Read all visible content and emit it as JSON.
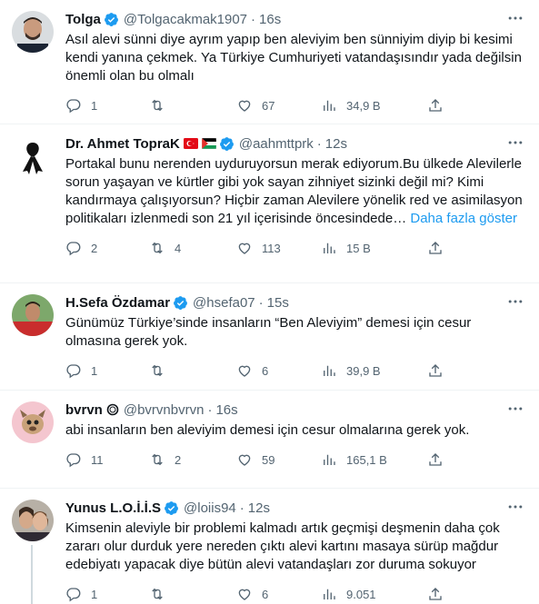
{
  "tweets": [
    {
      "name": "Tolga",
      "handle": "@Tolgacakmak1907",
      "time": "16s",
      "text": "Asıl alevi sünni diye ayrım yapıp ben aleviyim ben sünniyim diyip bi kesimi kendi yanına çekmek. Ya Türkiye Cumhuriyeti vatandaşısındır yada değilsin önemli olan bu olmalı",
      "show_more": "",
      "replies": "1",
      "retweets": "",
      "likes": "67",
      "views": "34,9 B"
    },
    {
      "name": "Dr. Ahmet TopraK",
      "handle": "@aahmttprk",
      "time": "12s",
      "text": "Portakal bunu nerenden uyduruyorsun merak ediyorum.Bu ülkede Alevilerle sorun yaşayan ve kürtler gibi yok sayan zihniyet sizinki değil mi? Kimi kandırmaya çalışıyorsun? Hiçbir zaman Alevilere yönelik red ve asimilasyon politikaları izlenmedi son 21 yıl içerisinde öncesindede…",
      "show_more": "Daha fazla göster",
      "replies": "2",
      "retweets": "4",
      "likes": "113",
      "views": "15 B"
    },
    {
      "name": "H.Sefa Özdamar",
      "handle": "@hsefa07",
      "time": "15s",
      "text": "Günümüz Türkiye’sinde insanların “Ben Aleviyim” demesi için cesur olmasına gerek yok.",
      "show_more": "",
      "replies": "1",
      "retweets": "",
      "likes": "6",
      "views": "39,9 B"
    },
    {
      "name": "bvrvn",
      "handle": "@bvrvnbvrvn",
      "time": "16s",
      "text": "abi insanların ben aleviyim demesi için cesur olmalarına gerek yok.",
      "show_more": "",
      "replies": "11",
      "retweets": "2",
      "likes": "59",
      "views": "165,1 B"
    },
    {
      "name": "Yunus L.O.İ.İ.S",
      "handle": "@loiis94",
      "time": "12s",
      "text": "Kimsenin aleviyle bir problemi kalmadı artık geçmişi deşmenin daha çok zararı olur durduk yere nereden çıktı alevi kartını masaya sürüp mağdur edebiyatı yapacak diye bütün alevi vatandaşları zor duruma sokuyor",
      "show_more": "",
      "replies": "1",
      "retweets": "",
      "likes": "6",
      "views": "9.051"
    }
  ],
  "colors": {
    "verified": "#1d9bf0",
    "muted": "#536471",
    "link": "#1d9bf0"
  },
  "icons": [
    "reply-icon",
    "retweet-icon",
    "like-icon",
    "views-icon",
    "share-icon",
    "more-icon",
    "verified-icon"
  ]
}
